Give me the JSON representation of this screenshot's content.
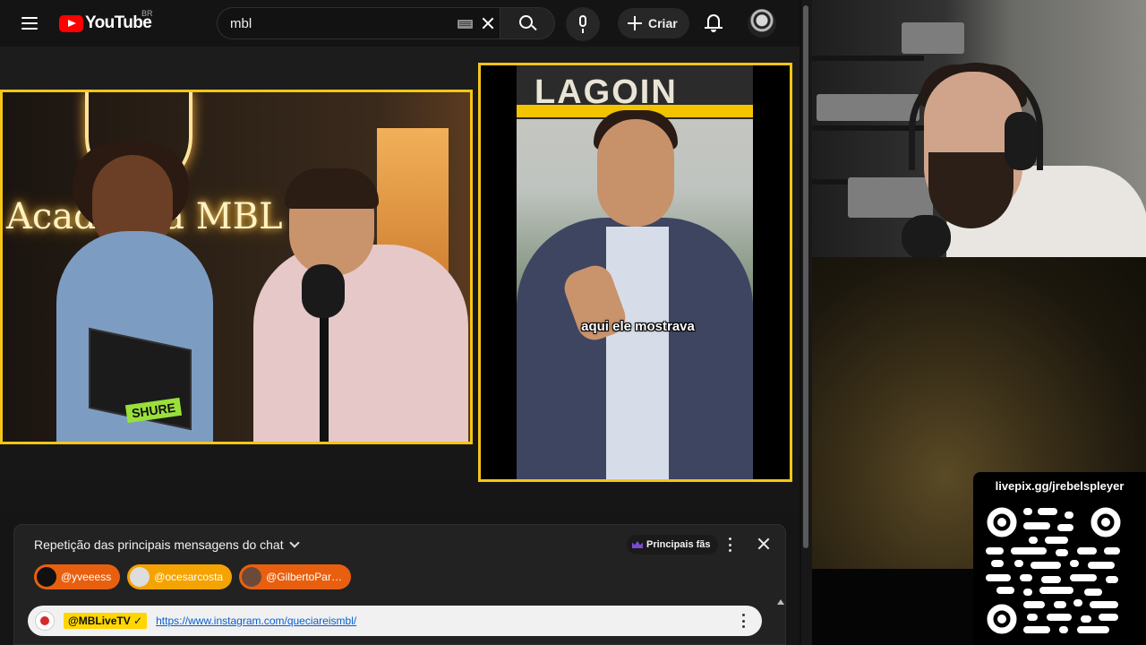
{
  "header": {
    "logo_text": "YouTube",
    "country": "BR",
    "search_value": "mbl",
    "create_label": "Criar"
  },
  "video": {
    "left_sign": "Academia MBL",
    "left_sticker": "SHURE",
    "right_sign": "LAGOIN",
    "caption_part1": "aqui ele ",
    "caption_part2": "mostrava"
  },
  "chat": {
    "title": "Repetição das principais mensagens do chat",
    "top_fans_label": "Principais fãs",
    "tickers": [
      {
        "name": "@yveeess",
        "color": "#e8600f"
      },
      {
        "name": "@ocesarcosta",
        "color": "#f5a300"
      },
      {
        "name": "@GilbertoPar…",
        "color": "#e8600f"
      }
    ],
    "pinned": {
      "author": "@MBLiveTV ✓",
      "link": "https://www.instagram.com/queciareismbl/"
    }
  },
  "overlay": {
    "qr_url_label": "livepix.gg/jrebelspleyer"
  },
  "colors": {
    "frame": "#f5c518",
    "brand_red": "#ff0000",
    "link_blue": "#065fd4"
  }
}
